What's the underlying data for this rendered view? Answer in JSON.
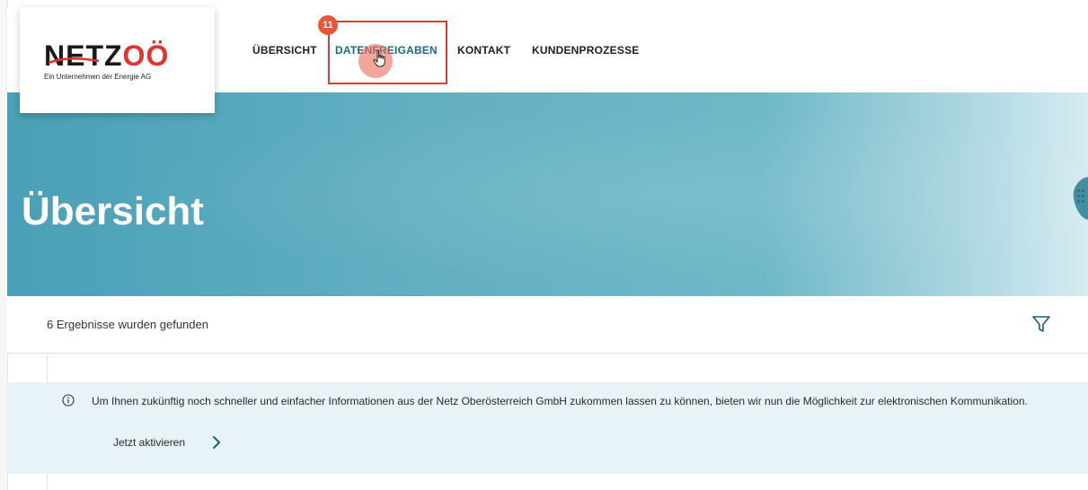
{
  "logo": {
    "brand_netz": "NETZ",
    "brand_oo": "OÖ",
    "tagline": "Ein Unternehmen der Energie AG"
  },
  "nav": {
    "items": [
      "ÜBERSICHT",
      "DATENFREIGABEN",
      "KONTAKT",
      "KUNDENPROZESSE"
    ],
    "active_index": 1,
    "badge_count": "11"
  },
  "hero": {
    "title": "Übersicht"
  },
  "results": {
    "count_text": "6 Ergebnisse wurden gefunden"
  },
  "info": {
    "message": "Um Ihnen zukünftig noch schneller und einfacher Informationen aus der Netz Oberösterreich GmbH zukommen lassen zu können, bieten wir nun die Möglichkeit zur elektronischen Kommunikation.",
    "action": "Jetzt aktivieren"
  },
  "colors": {
    "brand_red": "#e3312d",
    "hero_teal": "#5aaabd",
    "active_nav": "#1b6b86",
    "highlight": "#e03c3c",
    "info_bg": "#e7f3f6"
  },
  "icons": {
    "filter": "filter-funnel-icon",
    "info": "info-circle-icon",
    "chevron": "chevron-right-icon",
    "cursor": "hand-pointer-icon"
  }
}
